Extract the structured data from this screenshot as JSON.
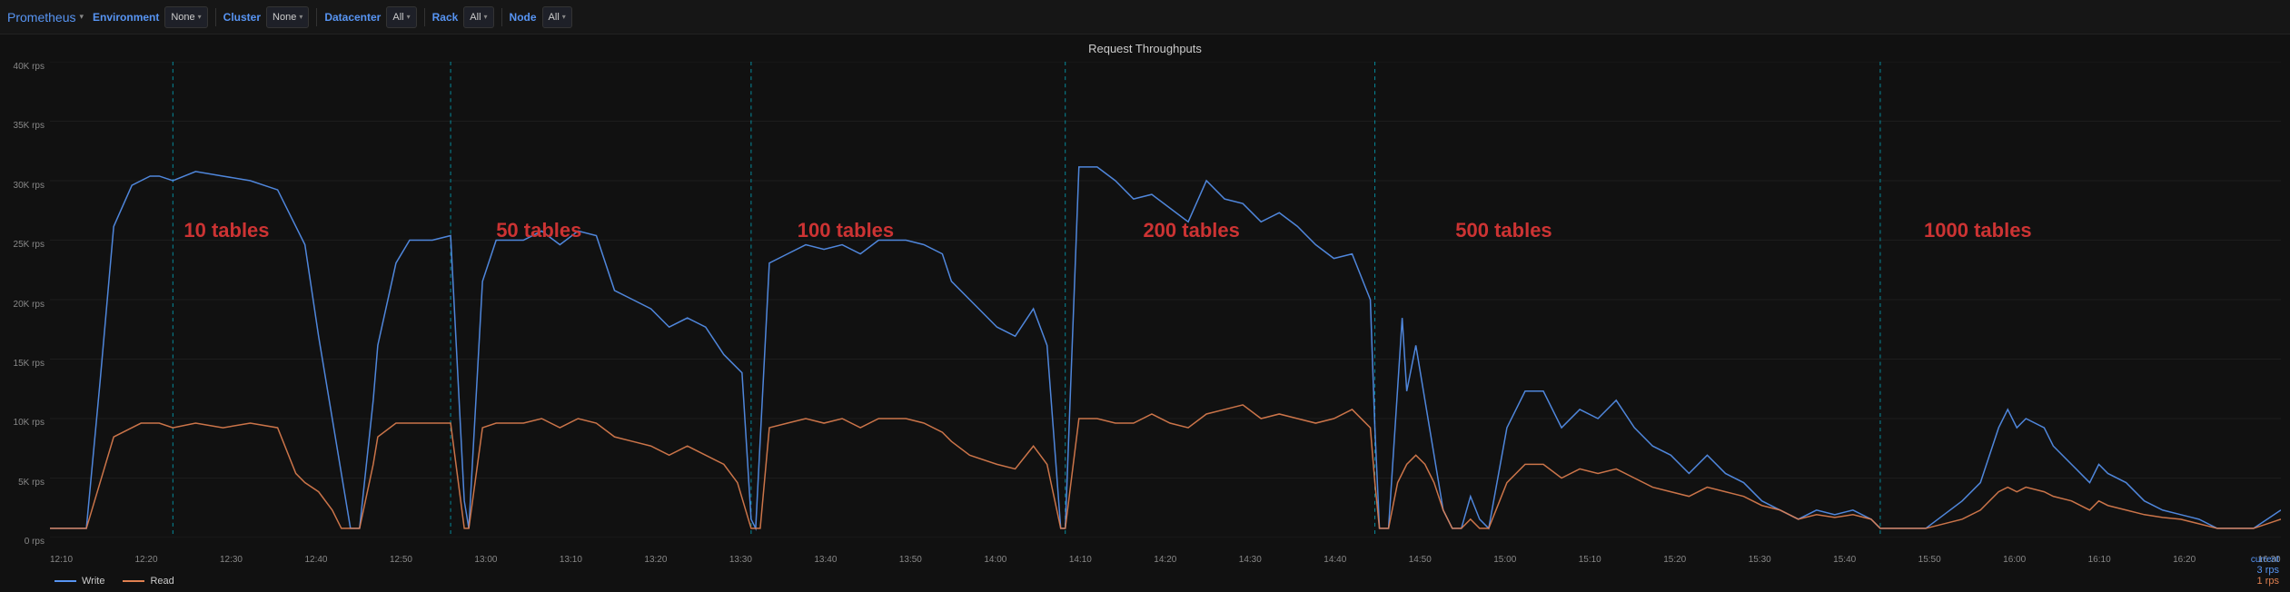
{
  "app": {
    "title": "Prometheus",
    "title_arrow": "▾"
  },
  "filters": [
    {
      "id": "environment",
      "label": "Environment",
      "value": "None",
      "color": "#5794f2"
    },
    {
      "id": "cluster",
      "label": "Cluster",
      "value": "None",
      "color": "#5794f2"
    },
    {
      "id": "datacenter",
      "label": "Datacenter",
      "value": "All",
      "color": "#5794f2"
    },
    {
      "id": "rack",
      "label": "Rack",
      "value": "All",
      "color": "#5794f2"
    },
    {
      "id": "node",
      "label": "Node",
      "value": "All",
      "color": "#5794f2"
    }
  ],
  "chart": {
    "title": "Request Throughputs",
    "y_labels": [
      "0 rps",
      "5K rps",
      "10K rps",
      "15K rps",
      "20K rps",
      "25K rps",
      "30K rps",
      "35K rps",
      "40K rps"
    ],
    "x_labels": [
      "12:10",
      "12:20",
      "12:30",
      "12:40",
      "12:50",
      "13:00",
      "13:10",
      "13:20",
      "13:30",
      "13:40",
      "13:50",
      "14:00",
      "14:10",
      "14:20",
      "14:30",
      "14:40",
      "14:50",
      "15:00",
      "15:10",
      "15:20",
      "15:30",
      "15:40",
      "15:50",
      "16:00",
      "16:10",
      "16:20",
      "16:30"
    ],
    "annotations": [
      {
        "label": "10 tables",
        "x_pct": 8
      },
      {
        "label": "50 tables",
        "x_pct": 22
      },
      {
        "label": "100 tables",
        "x_pct": 36
      },
      {
        "label": "200 tables",
        "x_pct": 51
      },
      {
        "label": "500 tables",
        "x_pct": 64
      },
      {
        "label": "1000 tables",
        "x_pct": 85
      }
    ],
    "vlines_pct": [
      5.5,
      18,
      31.5,
      45.5,
      59.5,
      82
    ]
  },
  "legend": {
    "items": [
      {
        "label": "Write",
        "color": "#5794f2"
      },
      {
        "label": "Read",
        "color": "#e08050"
      }
    ]
  },
  "current": {
    "label": "current",
    "write_val": "3 rps",
    "read_val": "1 rps"
  }
}
